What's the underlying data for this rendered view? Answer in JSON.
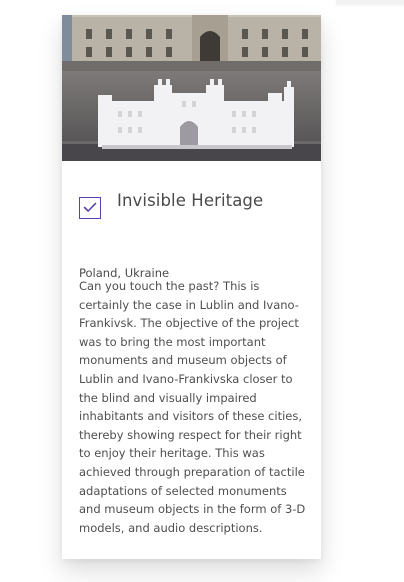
{
  "card": {
    "title": "Invisible Heritage",
    "checked": true,
    "location": "Poland, Ukraine",
    "description": "Can you touch the past? This is certainly the case in Lublin and Ivano-Frankivsk. The objective of the project was to bring the most important monuments and museum objects of Lublin and Ivano-Frankivska closer to the blind and visually impaired inhabitants and visitors of these cities, thereby showing respect for their right to enjoy their heritage. This was achieved through preparation of tactile adaptations of selected monuments and museum objects in the form of 3-D models, and audio descriptions."
  },
  "colors": {
    "accent": "#5b3fb0",
    "text": "#4a4a4a",
    "card_background": "#ffffff"
  },
  "icons": {
    "checkbox": "check-icon"
  }
}
